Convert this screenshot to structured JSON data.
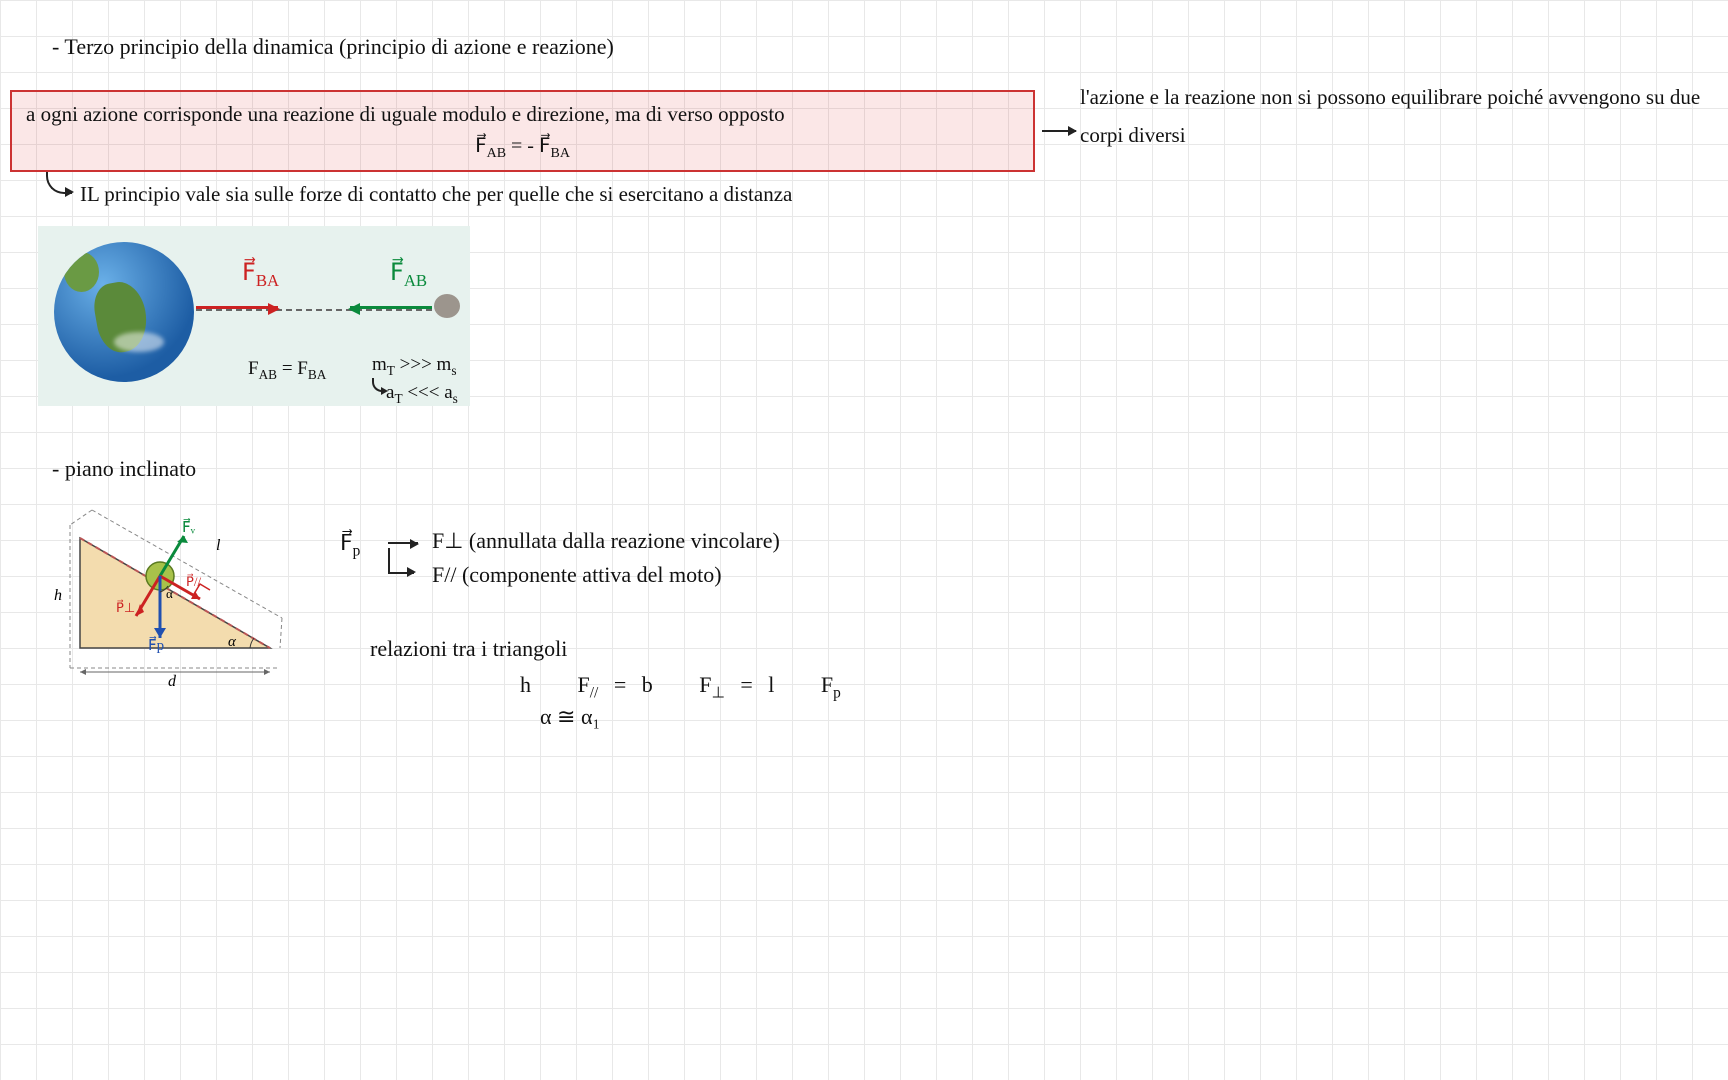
{
  "section1": {
    "title": "- Terzo principio della dinamica (principio di azione e reazione)",
    "highlight_text": "a ogni azione corrisponde una reazione di uguale modulo e direzione, ma di verso opposto",
    "highlight_eq": "F⃗ₐᵦ = - F⃗ᵦₐ",
    "highlight_eq_plain": "F⃗_AB = - F⃗_BA",
    "sub_line": "IL principio vale sia sulle forze di contatto che per quelle che si esercitano a distanza",
    "side_note": "l'azione e la reazione non si possono equilibrare poiché avvengono su due corpi diversi",
    "diagram": {
      "label_FBA": "F⃗_BA",
      "label_FAB": "F⃗_AB",
      "eq1": "F_AB = F_BA",
      "eq2": "m_T >>> m_s",
      "eq3": "a_T <<< a_s"
    }
  },
  "section2": {
    "title": "- piano inclinato",
    "fp_label": "F⃗p",
    "fperp": "F⊥ (annullata dalla reazione vincolare)",
    "fpar": "F// (componente attiva del moto)",
    "relazioni_title": "relazioni tra i triangoli",
    "rel_line1": "h : F// = b : F⊥ = l : Fp",
    "rel_line2": "α ≅ α₁",
    "incline_labels": {
      "height": "h",
      "base": "d",
      "length": "l",
      "angle": "α",
      "Fv": "F⃗v",
      "Fp": "F⃗p",
      "Pperp": "P⃗⊥",
      "Ppar": "P⃗//"
    }
  }
}
